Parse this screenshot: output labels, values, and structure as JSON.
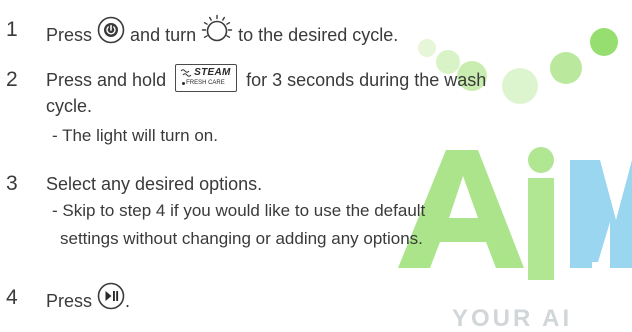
{
  "watermark": {
    "text": "YOUR AI",
    "colors": {
      "green": "#7ED957",
      "light_green": "#B9EC9C",
      "blue": "#6EC1E4",
      "light_blue": "#BFE6F4"
    }
  },
  "steps": [
    {
      "number": "1",
      "parts": {
        "before_power": "Press",
        "after_power": "and turn",
        "after_dial": "to the desired cycle."
      },
      "icons": [
        "power-button-icon",
        "cycle-dial-icon"
      ]
    },
    {
      "number": "2",
      "parts": {
        "before_button": "Press and hold",
        "after_button": "for 3 seconds during the wash",
        "continuation": "cycle.",
        "note": "- The light will turn on."
      },
      "button": {
        "title": "STEAM",
        "subtitle": "FRESH CARE"
      }
    },
    {
      "number": "3",
      "text": "Select any desired options.",
      "notes": [
        "- Skip to step 4 if you would like to use the default",
        "settings without changing or adding any options."
      ]
    },
    {
      "number": "4",
      "parts": {
        "before_icon": "Press",
        "after_icon": "."
      },
      "icons": [
        "start-pause-icon"
      ]
    }
  ]
}
